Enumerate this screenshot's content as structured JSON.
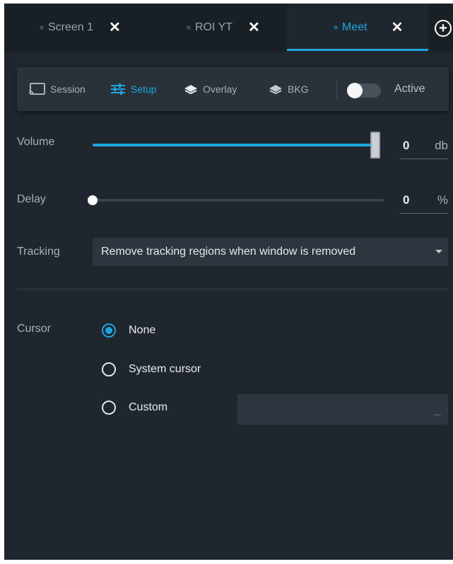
{
  "tabs": [
    {
      "label": "Screen 1",
      "active": false
    },
    {
      "label": "ROI YT",
      "active": false
    },
    {
      "label": "Meet",
      "active": true
    }
  ],
  "icons": {
    "tab_close": "close-icon",
    "add_tab": "add-circle-icon",
    "session": "cast-screen-icon",
    "setup": "sliders-icon",
    "overlay": "layers-icon",
    "bkg": "layers-background-icon"
  },
  "tab_close_glyph": "✕",
  "add_tab_glyph": "+",
  "subnav": {
    "session": "Session",
    "setup": "Setup",
    "overlay": "Overlay",
    "bkg": "BKG",
    "active_toggle_label": "Active",
    "active_toggle_on": false,
    "selected": "setup"
  },
  "volume": {
    "label": "Volume",
    "value": "0",
    "unit": "db",
    "level_fraction": 1.0
  },
  "delay": {
    "label": "Delay",
    "value": "0",
    "unit": "%",
    "level_fraction": 0.0
  },
  "tracking": {
    "label": "Tracking",
    "value": "Remove tracking regions when window is removed"
  },
  "cursor": {
    "label": "Cursor",
    "options": [
      "None",
      "System cursor",
      "Custom"
    ],
    "selected": "None",
    "custom_field_value": "",
    "browse_label": "..."
  },
  "colors": {
    "accent": "#1ea5e0",
    "background": "#1f262d",
    "tabbar": "#182026",
    "panel": "#2a3239"
  }
}
